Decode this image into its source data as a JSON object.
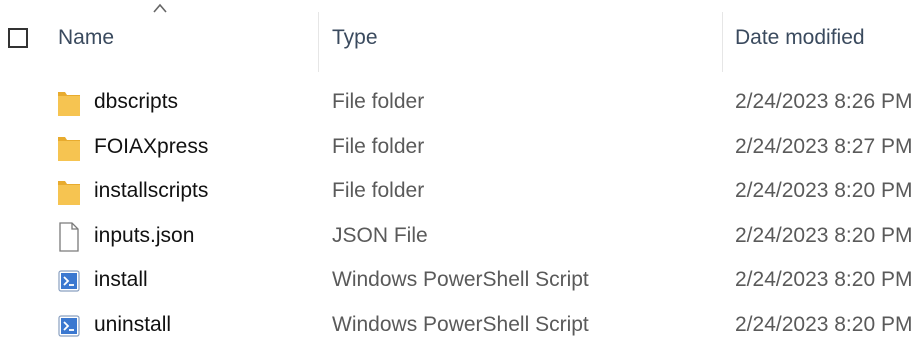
{
  "header": {
    "name_label": "Name",
    "type_label": "Type",
    "date_label": "Date modified"
  },
  "rows": [
    {
      "name": "dbscripts",
      "type": "File folder",
      "date": "2/24/2023 8:26 PM",
      "icon": "folder-icon"
    },
    {
      "name": "FOIAXpress",
      "type": "File folder",
      "date": "2/24/2023 8:27 PM",
      "icon": "folder-icon"
    },
    {
      "name": "installscripts",
      "type": "File folder",
      "date": "2/24/2023 8:20 PM",
      "icon": "folder-icon"
    },
    {
      "name": "inputs.json",
      "type": "JSON File",
      "date": "2/24/2023 8:20 PM",
      "icon": "file-icon"
    },
    {
      "name": "install",
      "type": "Windows PowerShell Script",
      "date": "2/24/2023 8:20 PM",
      "icon": "powershell-script-icon"
    },
    {
      "name": "uninstall",
      "type": "Windows PowerShell Script",
      "date": "2/24/2023 8:20 PM",
      "icon": "powershell-script-icon"
    }
  ],
  "colors": {
    "folder": "#f6c451",
    "header_text": "#3a4a5e",
    "secondary_text": "#5a5a5a"
  }
}
